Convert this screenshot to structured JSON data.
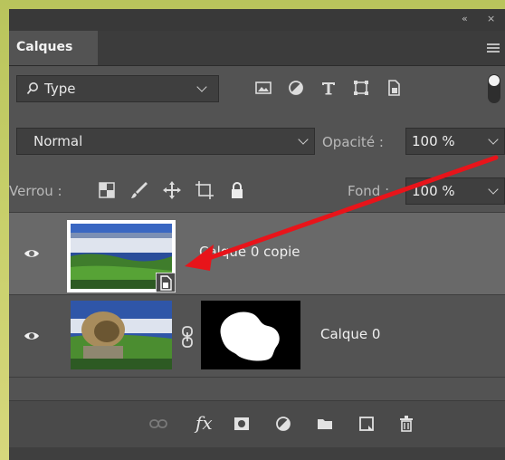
{
  "window": {
    "collapse_label": "«",
    "close_label": "×"
  },
  "panel": {
    "tab_title": "Calques"
  },
  "filter": {
    "label": "Type",
    "icons": [
      "image-filter-icon",
      "adjustment-filter-icon",
      "type-filter-icon",
      "shape-filter-icon",
      "smart-object-filter-icon"
    ],
    "toggle_state": "off"
  },
  "blend": {
    "mode": "Normal",
    "opacity_label": "Opacité :",
    "opacity_value": "100 %"
  },
  "lock": {
    "label": "Verrou :",
    "icons": [
      "lock-transparent-pixels-icon",
      "lock-image-pixels-icon",
      "lock-position-icon",
      "lock-artboard-icon",
      "lock-all-icon"
    ],
    "fill_label": "Fond :",
    "fill_value": "100 %"
  },
  "layers": [
    {
      "name": "Calque 0 copie",
      "visible": true,
      "selected": true,
      "smart_object": true
    },
    {
      "name": "Calque 0",
      "visible": true,
      "selected": false,
      "has_mask": true
    }
  ],
  "bottom_toolbar": {
    "fx_label": "fx",
    "icons": [
      "link-layers-icon",
      "layer-style-icon",
      "add-mask-icon",
      "adjustment-layer-icon",
      "new-group-icon",
      "new-layer-icon",
      "delete-layer-icon"
    ]
  },
  "annotation": {
    "arrow_color": "#e8141a"
  },
  "colors": {
    "panel_bg": "#535353",
    "header_bg": "#3c3c3c",
    "selected_row": "#696969",
    "text": "#efefef"
  }
}
